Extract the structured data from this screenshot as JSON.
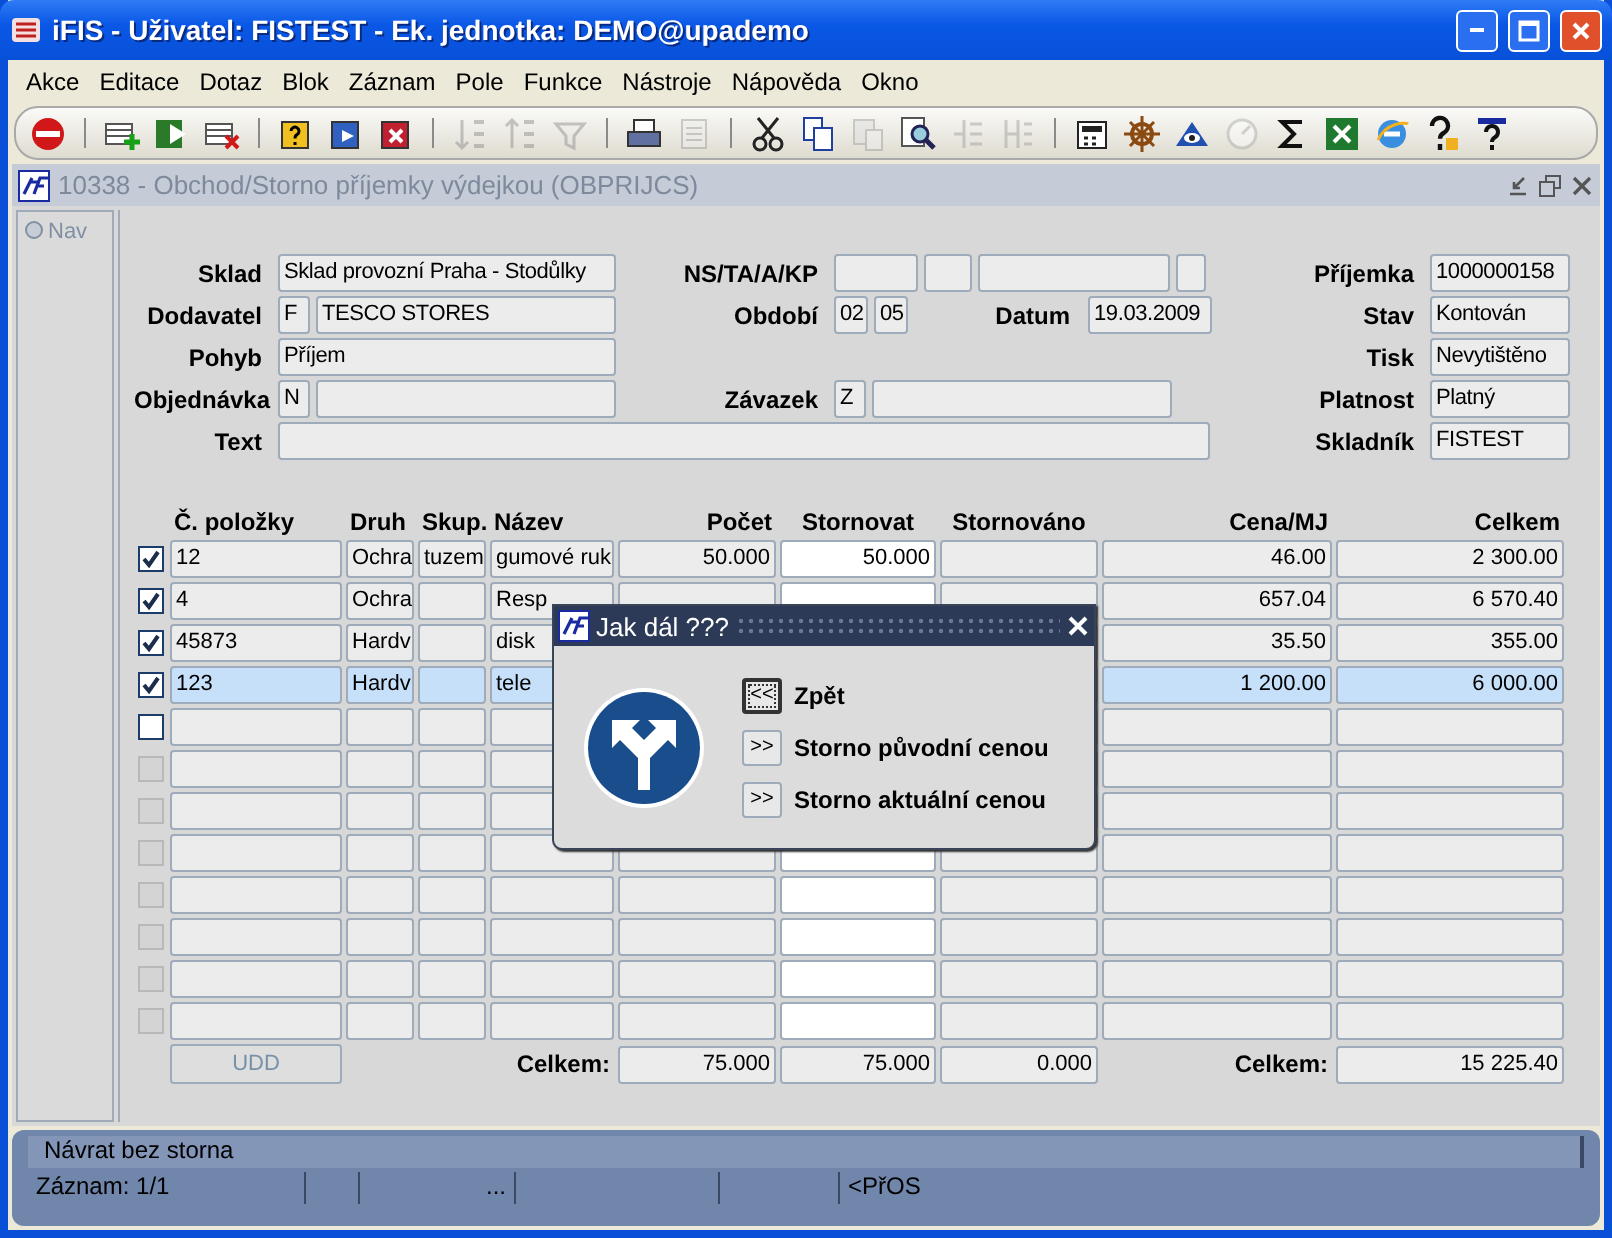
{
  "window": {
    "title": "iFIS - Uživatel: FISTEST - Ek. jednotka: DEMO@upademo"
  },
  "menu": [
    "Akce",
    "Editace",
    "Dotaz",
    "Blok",
    "Záznam",
    "Pole",
    "Funkce",
    "Nástroje",
    "Nápověda",
    "Okno"
  ],
  "toolbar": [
    [
      {
        "disabled": false
      }
    ],
    [
      {
        "disabled": false
      },
      {
        "disabled": false
      },
      {
        "disabled": false
      }
    ],
    [
      {
        "disabled": false
      },
      {
        "disabled": false
      },
      {
        "disabled": false
      }
    ],
    [
      {
        "disabled": true
      },
      {
        "disabled": true
      },
      {
        "disabled": true
      }
    ],
    [
      {
        "disabled": false
      },
      {
        "disabled": true
      }
    ],
    [
      {
        "disabled": false
      },
      {
        "disabled": false
      },
      {
        "disabled": true
      },
      {
        "disabled": false
      },
      {
        "disabled": true
      },
      {
        "disabled": true
      }
    ],
    [
      {
        "disabled": false
      },
      {
        "disabled": false
      },
      {
        "disabled": false
      },
      {
        "disabled": true
      },
      {
        "disabled": false
      },
      {
        "disabled": false
      },
      {
        "disabled": false
      },
      {
        "disabled": false
      },
      {
        "disabled": false
      }
    ]
  ],
  "form": {
    "title": "10338 - Obchod/Storno příjemky výdejkou (OBPRIJCS)",
    "nav": {
      "label": "Nav",
      "selected": false
    },
    "header": {
      "sklad": {
        "label": "Sklad",
        "value": "Sklad provozní Praha - Stodůlky"
      },
      "dodavatel": {
        "label": "Dodavatel",
        "code": "F",
        "value": "TESCO STORES"
      },
      "pohyb": {
        "label": "Pohyb",
        "value": "Příjem"
      },
      "objednavka": {
        "label": "Objednávka",
        "code": "N"
      },
      "text": {
        "label": "Text"
      },
      "ns_ta_a_kp": {
        "label": "NS/TA/A/KP"
      },
      "obdobi": {
        "label": "Období",
        "values": [
          "02",
          "05"
        ]
      },
      "datum": {
        "label": "Datum",
        "value": "19.03.2009"
      },
      "zavazek": {
        "label": "Závazek",
        "code": "Z"
      },
      "prijemka": {
        "label": "Příjemka",
        "value": "1000000158"
      },
      "stav": {
        "label": "Stav",
        "value": "Kontován"
      },
      "tisk": {
        "label": "Tisk",
        "value": "Nevytištěno"
      },
      "platnost": {
        "label": "Platnost",
        "value": "Platný"
      },
      "skladnik": {
        "label": "Skladník",
        "value": "FISTEST"
      }
    },
    "table": {
      "columns": [
        "Č. položky",
        "Druh",
        "Skup.",
        "Název",
        "Počet",
        "Stornovat",
        "Stornováno",
        "Cena/MJ",
        "Celkem"
      ],
      "rows": [
        {
          "checked": true,
          "disabled": false,
          "selected": false,
          "cells": {
            "polozka": "12",
            "druh": "Ochra",
            "skup": "tuzem",
            "nazev": "gumové ruk",
            "pocet": "50.000",
            "stornovat": "50.000",
            "cena": "46.00",
            "celkem": "2 300.00"
          }
        },
        {
          "checked": true,
          "disabled": false,
          "selected": false,
          "cells": {
            "polozka": "4",
            "druh": "Ochra",
            "nazev": "Resp",
            "cena": "657.04",
            "celkem": "6 570.40"
          }
        },
        {
          "checked": true,
          "disabled": false,
          "selected": false,
          "cells": {
            "polozka": "45873",
            "druh": "Hardv",
            "nazev": "disk",
            "cena": "35.50",
            "celkem": "355.00"
          }
        },
        {
          "checked": true,
          "disabled": false,
          "selected": true,
          "cells": {
            "polozka": "123",
            "druh": "Hardv",
            "nazev": "tele",
            "cena": "1 200.00",
            "celkem": "6 000.00"
          }
        },
        {
          "checked": false,
          "disabled": false,
          "selected": false,
          "cells": {}
        },
        {
          "checked": false,
          "disabled": true,
          "selected": false,
          "cells": {}
        },
        {
          "checked": false,
          "disabled": true,
          "selected": false,
          "cells": {}
        },
        {
          "checked": false,
          "disabled": true,
          "selected": false,
          "cells": {}
        },
        {
          "checked": false,
          "disabled": true,
          "selected": false,
          "cells": {}
        },
        {
          "checked": false,
          "disabled": true,
          "selected": false,
          "cells": {}
        },
        {
          "checked": false,
          "disabled": true,
          "selected": false,
          "cells": {}
        },
        {
          "checked": false,
          "disabled": true,
          "selected": false,
          "cells": {}
        }
      ],
      "totals": {
        "button": {
          "label": "UDD",
          "disabled": true
        },
        "label_1": "Celkem:",
        "pocet": "75.000",
        "stornovat": "75.000",
        "stornovano": "0.000",
        "label_2": "Celkem:",
        "celkem": "15 225.40"
      }
    }
  },
  "dialog": {
    "title": "Jak dál ???",
    "options": [
      {
        "symbol": "<<",
        "label": "Zpět",
        "selected": true
      },
      {
        "symbol": ">>",
        "label": "Storno původní cenou",
        "selected": false
      },
      {
        "symbol": ">>",
        "label": "Storno aktuální cenou",
        "selected": false
      }
    ]
  },
  "status_bar": {
    "message": "Návrat bez storna",
    "fields": [
      "Záznam: 1/1",
      "...",
      "<PřOS"
    ]
  }
}
